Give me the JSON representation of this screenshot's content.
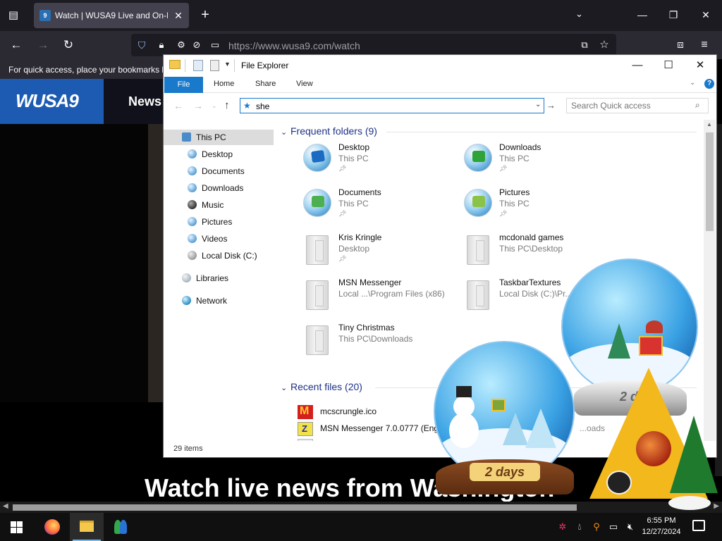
{
  "browser": {
    "tab_title": "Watch | WUSA9 Live and On-De",
    "url": "https://www.wusa9.com/watch",
    "bookmarks_hint": "For quick access, place your bookmarks h"
  },
  "website": {
    "logo": "WUSA9",
    "nav_news": "News",
    "headline": "Watch live news from Washington"
  },
  "explorer": {
    "title": "File Explorer",
    "ribbon_tabs": [
      "File",
      "Home",
      "Share",
      "View"
    ],
    "address_value": "she",
    "search_placeholder": "Search Quick access",
    "nav_pane": {
      "this_pc": "This PC",
      "items": [
        "Desktop",
        "Documents",
        "Downloads",
        "Music",
        "Pictures",
        "Videos",
        "Local Disk (C:)"
      ],
      "libraries": "Libraries",
      "network": "Network"
    },
    "frequent_header": "Frequent folders (9)",
    "frequent": [
      {
        "name": "Desktop",
        "location": "This PC",
        "pinned": true,
        "icon": "desktop-globe"
      },
      {
        "name": "Downloads",
        "location": "This PC",
        "pinned": true,
        "icon": "downloads-globe"
      },
      {
        "name": "Documents",
        "location": "This PC",
        "pinned": true,
        "icon": "documents-globe"
      },
      {
        "name": "Pictures",
        "location": "This PC",
        "pinned": true,
        "icon": "pictures-globe"
      },
      {
        "name": "Kris Kringle",
        "location": "Desktop",
        "pinned": true,
        "icon": "plain-folder"
      },
      {
        "name": "mcdonald games",
        "location": "This PC\\Desktop",
        "pinned": false,
        "icon": "plain-folder"
      },
      {
        "name": "MSN Messenger",
        "location": "Local ...\\Program Files (x86)",
        "pinned": false,
        "icon": "plain-folder"
      },
      {
        "name": "TaskbarTextures",
        "location": "Local Disk (C:)\\Pr...",
        "pinned": false,
        "icon": "plain-folder"
      },
      {
        "name": "Tiny Christmas",
        "location": "This PC\\Downloads",
        "pinned": false,
        "icon": "plain-folder"
      }
    ],
    "recent_header": "Recent files (20)",
    "recent": [
      {
        "name": "mcscrungle.ico",
        "icon": "mcdonalds-icon"
      },
      {
        "name": "MSN Messenger 7.0.0777 (Eng",
        "icon": "archive-icon"
      }
    ],
    "recent_partial_location": "...oads",
    "status": "29 items"
  },
  "gadgets": {
    "globe_front_label": "2 days",
    "globe_back_label": "2 d"
  },
  "taskbar": {
    "time": "6:55 PM",
    "date": "12/27/2024"
  },
  "colors": {
    "accent": "#1979ca",
    "browser_bg": "#1c1b22",
    "group_header": "#1e3287",
    "wusa_blue": "#1d5bb3"
  }
}
